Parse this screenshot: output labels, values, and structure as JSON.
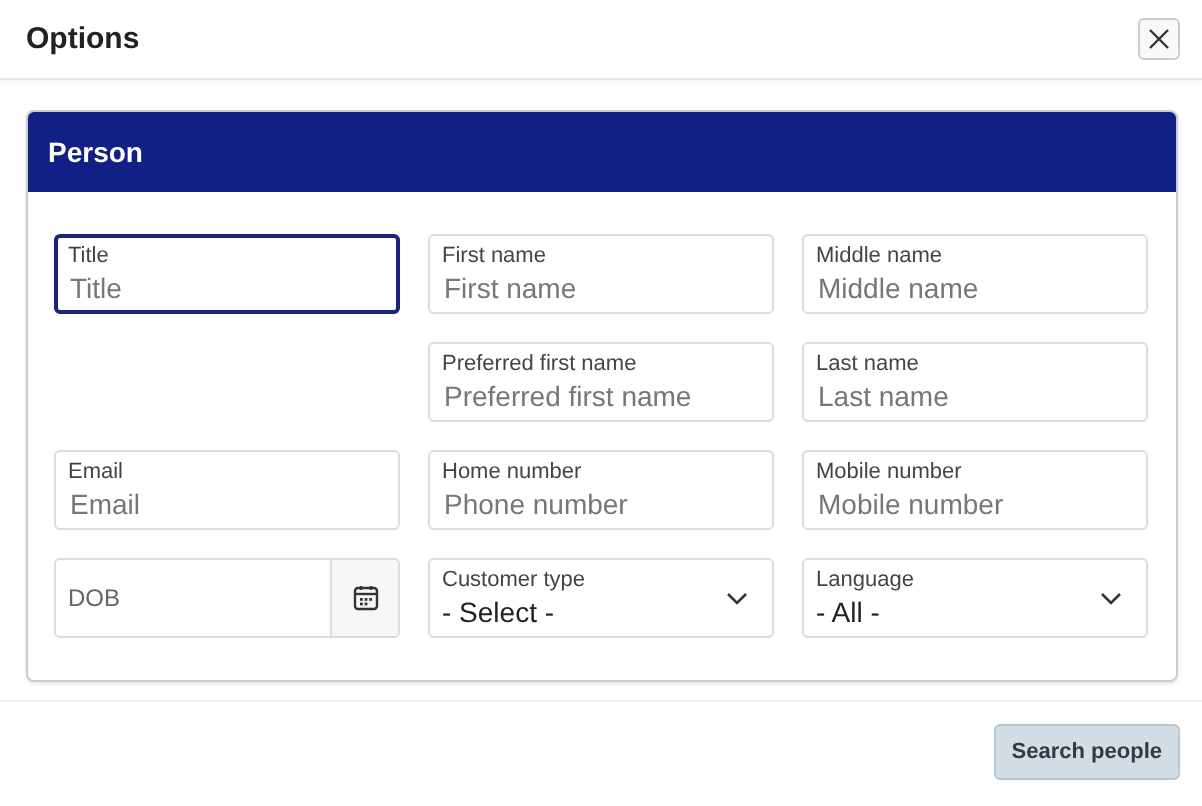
{
  "dialog": {
    "title": "Options",
    "close": true
  },
  "panel": {
    "title": "Person",
    "rows": [
      {
        "fields": [
          {
            "kind": "text",
            "label": "Title",
            "placeholder": "Title",
            "focused": true
          },
          {
            "kind": "text",
            "label": "First name",
            "placeholder": "First name",
            "focused": false
          },
          {
            "kind": "text",
            "label": "Middle name",
            "placeholder": "Middle name",
            "focused": false
          }
        ]
      },
      {
        "fields": [
          {
            "kind": "spacer"
          },
          {
            "kind": "text",
            "label": "Preferred first name",
            "placeholder": "Preferred first name",
            "focused": false
          },
          {
            "kind": "text",
            "label": "Last name",
            "placeholder": "Last name",
            "focused": false
          }
        ]
      },
      {
        "fields": [
          {
            "kind": "text",
            "label": "Email",
            "placeholder": "Email",
            "focused": false
          },
          {
            "kind": "text",
            "label": "Home number",
            "placeholder": "Phone number",
            "focused": false
          },
          {
            "kind": "text",
            "label": "Mobile number",
            "placeholder": "Mobile number",
            "focused": false
          }
        ]
      },
      {
        "fields": [
          {
            "kind": "date",
            "placeholder": "DOB",
            "focused": false
          },
          {
            "kind": "select",
            "label": "Customer type",
            "value": "- Select -",
            "focused": false
          },
          {
            "kind": "select",
            "label": "Language",
            "value": "- All -",
            "focused": false
          }
        ]
      }
    ]
  },
  "footer": {
    "button": "Search people"
  }
}
